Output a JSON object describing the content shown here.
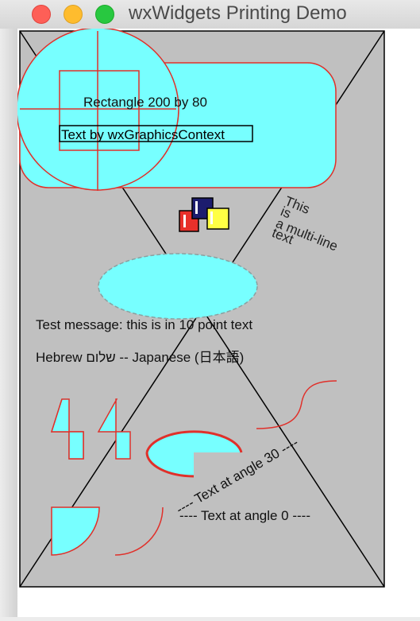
{
  "window": {
    "title": "wxWidgets Printing Demo"
  },
  "canvas": {
    "background": "#c0c0c0",
    "fill_color": "#77ffff",
    "outline_color": "#e0302a",
    "rect_label": "Rectangle 200 by 80",
    "graphics_label": "Text by wxGraphicsContext",
    "multiline_text": [
      "This",
      "is",
      "a multi-line",
      "text"
    ],
    "test_message": "Test message: this is in 10 point text",
    "hebrew_line": "Hebrew    שלום -- Japanese (日本語)",
    "angle30_text": "---- Text at angle 30 ----",
    "angle0_text": "---- Text at angle 0 ----",
    "icon_name": "bitmap-squares-icon"
  }
}
